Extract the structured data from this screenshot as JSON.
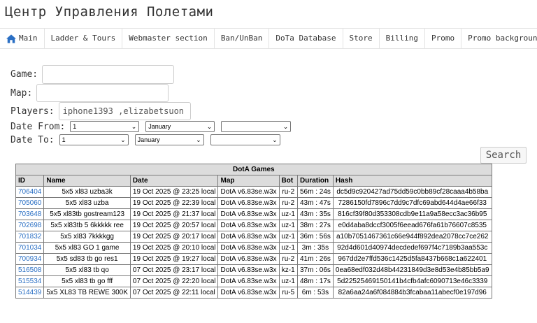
{
  "header": {
    "title": "Центр Управления Полетами"
  },
  "nav": [
    {
      "label": "Main",
      "icon": "home-icon"
    },
    {
      "label": "Ladder & Tours"
    },
    {
      "label": "Webmaster section"
    },
    {
      "label": "Ban/UnBan"
    },
    {
      "label": "DoTa Database"
    },
    {
      "label": "Store"
    },
    {
      "label": "Billing"
    },
    {
      "label": "Promo"
    },
    {
      "label": "Promo background"
    }
  ],
  "filters": {
    "game_label": "Game:",
    "game_value": "",
    "map_label": "Map:",
    "map_value": "",
    "players_label": "Players:",
    "players_value": "iphone1393 ,elizabetsuon",
    "date_from_label": "Date From:",
    "date_from_day": "1",
    "date_from_month": "January",
    "date_from_year": "",
    "date_to_label": "Date To:",
    "date_to_day": "1",
    "date_to_month": "January",
    "date_to_year": "",
    "search_label": "Search"
  },
  "table": {
    "caption": "DotA Games",
    "columns": [
      "ID",
      "Name",
      "Date",
      "Map",
      "Bot",
      "Duration",
      "Hash"
    ],
    "rows": [
      [
        "706404",
        "5x5 xl83 uzba3k",
        "19 Oct 2025 @ 23:25 local",
        "DotA v6.83se.w3x",
        "ru-2",
        "56m : 24s",
        "dc5d9c920427ad75dd59c0bb89cf28caaa4b58ba"
      ],
      [
        "705060",
        "5x5 xl83 uzba",
        "19 Oct 2025 @ 22:39 local",
        "DotA v6.83se.w3x",
        "ru-2",
        "43m : 47s",
        "7286150fd7896c7dd9c7dfc69abd644d4ae66f33"
      ],
      [
        "703648",
        "5x5 xl83tb gostream123",
        "19 Oct 2025 @ 21:37 local",
        "DotA v6.83se.w3x",
        "uz-1",
        "43m : 35s",
        "816cf39f80d353308cdb9e11a9a58ecc3ac36b95"
      ],
      [
        "702698",
        "5x5 xl83tb 5 6kkkkk ree",
        "19 Oct 2025 @ 20:57 local",
        "DotA v6.83se.w3x",
        "uz-1",
        "38m : 27s",
        "e0d4aba8dccf3005f6eead676fa61b76607c8535"
      ],
      [
        "701832",
        "5x5 xl83 7kkkkgg",
        "19 Oct 2025 @ 20:17 local",
        "DotA v6.83se.w3x",
        "uz-1",
        "36m : 56s",
        "a10b7051467361c66e944f892dea2078cc7ce262"
      ],
      [
        "701034",
        "5x5 xl83 GO 1 game",
        "19 Oct 2025 @ 20:10 local",
        "DotA v6.83se.w3x",
        "uz-1",
        "3m : 35s",
        "92d4d601d40974decdedef697f4c7189b3aa553c"
      ],
      [
        "700934",
        "5x5 sd83 tb go res1",
        "19 Oct 2025 @ 19:27 local",
        "DotA v6.83se.w3x",
        "ru-2",
        "41m : 26s",
        "967dd2e7ffd536c1425d5fa8437b668c1a622401"
      ],
      [
        "516508",
        "5x5 xl83 tb qo",
        "07 Oct 2025 @ 23:17 local",
        "DotA v6.83se.w3x",
        "kz-1",
        "37m : 06s",
        "0ea68edf032d48b44231849d3e8d53e4b85bb5a9"
      ],
      [
        "515534",
        "5x5 xl83 tb go fff",
        "07 Oct 2025 @ 22:20 local",
        "DotA v6.83se.w3x",
        "uz-1",
        "48m : 17s",
        "5d22525469150141b4cfb4afc6090713e46c3339"
      ],
      [
        "514439",
        "5x5 XL83 TB REWE 300K",
        "07 Oct 2025 @ 22:11 local",
        "DotA v6.83se.w3x",
        "ru-5",
        "6m : 53s",
        "82a6aa24a6f084884b3fcabaa11abecf0e197d96"
      ]
    ]
  },
  "colors": {
    "link": "#2a6fc4",
    "home_icon": "#2a6fc4",
    "table_header_bg": "#dcdcdc"
  }
}
